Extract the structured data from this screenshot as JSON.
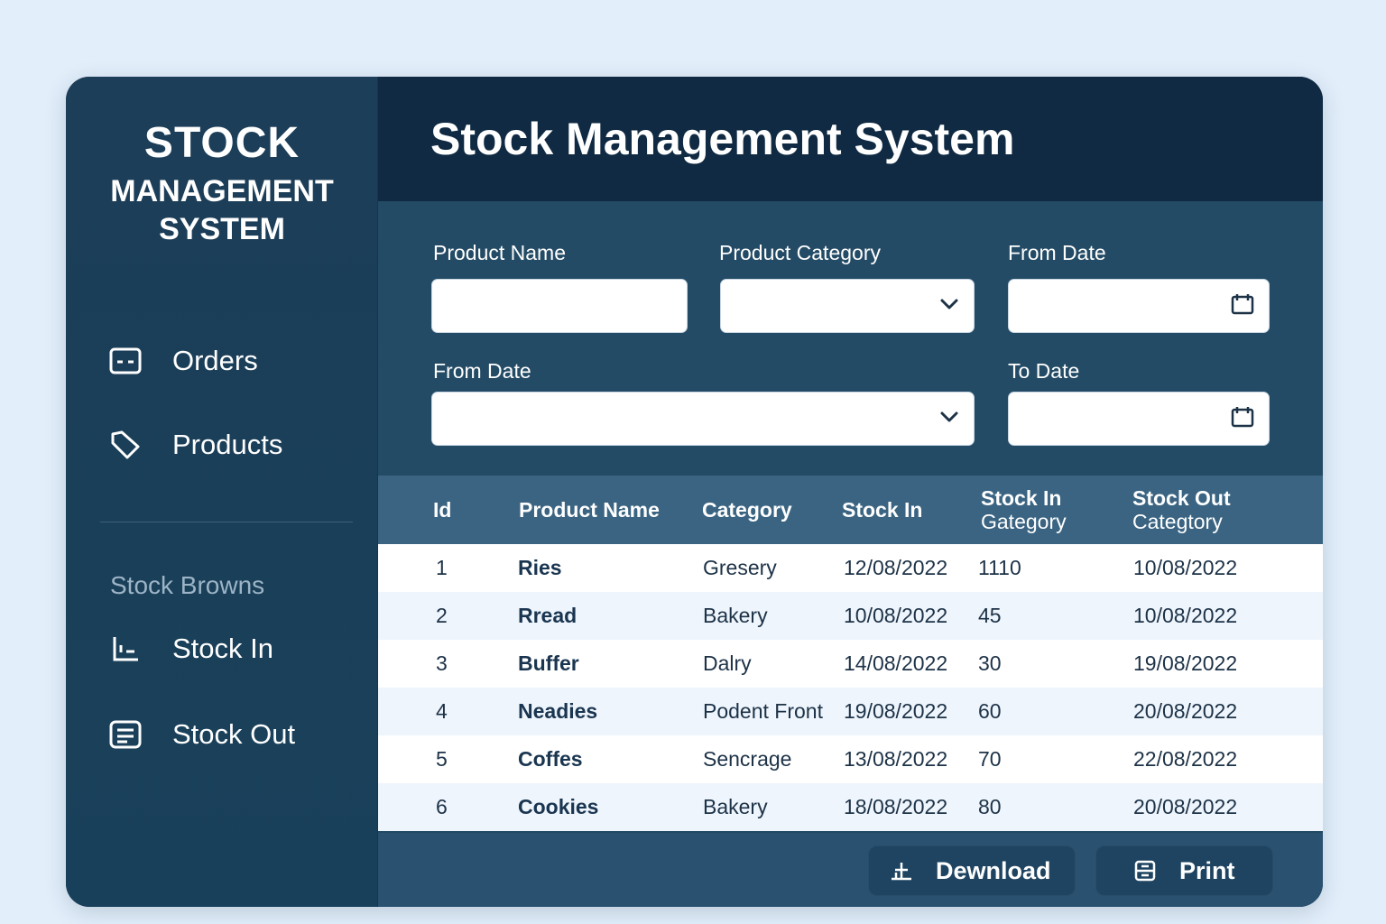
{
  "sidebar": {
    "brand_line1": "STOCK",
    "brand_line2": "MANAGEMENT",
    "brand_line3": "SYSTEM",
    "nav": [
      {
        "label": "Orders",
        "icon": "orders-icon"
      },
      {
        "label": "Products",
        "icon": "tag-icon"
      }
    ],
    "section_label": "Stock Browns",
    "section_nav": [
      {
        "label": "Stock In",
        "icon": "stock-in-icon"
      },
      {
        "label": "Stock Out",
        "icon": "stock-out-icon"
      }
    ]
  },
  "header": {
    "title": "Stock Management System"
  },
  "filters": {
    "product_name_label": "Product Name",
    "product_category_label": "Product Category",
    "from_date_label": "From Date",
    "from_date2_label": "From Date",
    "to_date_label": "To Date"
  },
  "table": {
    "headers": {
      "id": "Id",
      "product_name": "Product Name",
      "category": "Category",
      "stock_in": "Stock In",
      "stock_in_category_1": "Stock In",
      "stock_in_category_2": "Gategory",
      "stock_out_category_1": "Stock Out",
      "stock_out_category_2": "Categtory"
    },
    "rows": [
      {
        "id": "1",
        "name": "Ries",
        "category": "Gresery",
        "stock_in": "12/08/2022",
        "stock_in_cat": "1110",
        "stock_out_cat": "10/08/2022"
      },
      {
        "id": "2",
        "name": "Rread",
        "category": "Bakery",
        "stock_in": "10/08/2022",
        "stock_in_cat": "45",
        "stock_out_cat": "10/08/2022"
      },
      {
        "id": "3",
        "name": "Buffer",
        "category": "Dalry",
        "stock_in": "14/08/2022",
        "stock_in_cat": "30",
        "stock_out_cat": "19/08/2022"
      },
      {
        "id": "4",
        "name": "Neadies",
        "category": "Podent Front",
        "stock_in": "19/08/2022",
        "stock_in_cat": "60",
        "stock_out_cat": "20/08/2022"
      },
      {
        "id": "5",
        "name": "Coffes",
        "category": "Sencrage",
        "stock_in": "13/08/2022",
        "stock_in_cat": "70",
        "stock_out_cat": "22/08/2022"
      },
      {
        "id": "6",
        "name": "Cookies",
        "category": "Bakery",
        "stock_in": "18/08/2022",
        "stock_in_cat": "80",
        "stock_out_cat": "20/08/2022"
      }
    ]
  },
  "footer": {
    "download_label": "Dewnload",
    "print_label": "Print"
  },
  "colors": {
    "page_bg": "#e2eefa",
    "sidebar_bg": "#1c3e58",
    "header_bg": "#0f2a42",
    "table_header_bg": "#3a6482"
  }
}
